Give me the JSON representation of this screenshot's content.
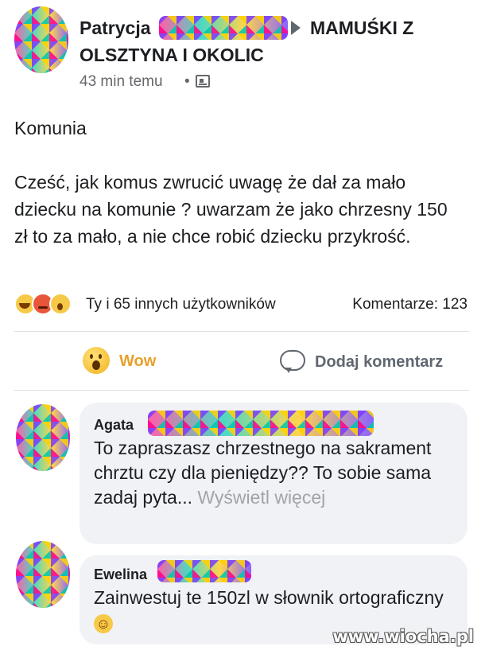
{
  "post": {
    "author": "Patrycja",
    "group_line1": "MAMUŚKI Z",
    "group_line2": "OLSZTYNA I OKOLIC",
    "time": "43 min temu",
    "dot": "•",
    "title": "Komunia",
    "body": "Cześć, jak komus zwrucić uwagę że dał za mało dziecku na komunie ? uwarzam że jako chrzesny 150 zł to za mało, a nie chce robić dziecku przykrość.",
    "reactions_text": "Ty i 65 innych użytkowników",
    "comments_count": "Komentarze: 123"
  },
  "actions": {
    "wow_label": "Wow",
    "comment_label": "Dodaj komentarz"
  },
  "comments": [
    {
      "author": "Agata",
      "text_main": "To zapraszasz chrzestnego na sakrament chrztu czy dla pieniędzy?? To sobie sama zadaj pyta...",
      "see_more": "Wyświetl więcej"
    },
    {
      "author": "Ewelina",
      "text_main": "Zainwestuj te 150zl w słownik ortograficzny",
      "emoji": "☺"
    }
  ],
  "watermark": "www.wiocha.pl",
  "colors": {
    "accent_wow": "#e8a02c",
    "text": "#1c1e21",
    "muted": "#65676b",
    "bubble": "#f0f2f5"
  },
  "icons": [
    "globe-icon",
    "wow-reaction-icon",
    "comment-icon",
    "haha-icon",
    "angry-icon",
    "smile-emoji-icon"
  ]
}
